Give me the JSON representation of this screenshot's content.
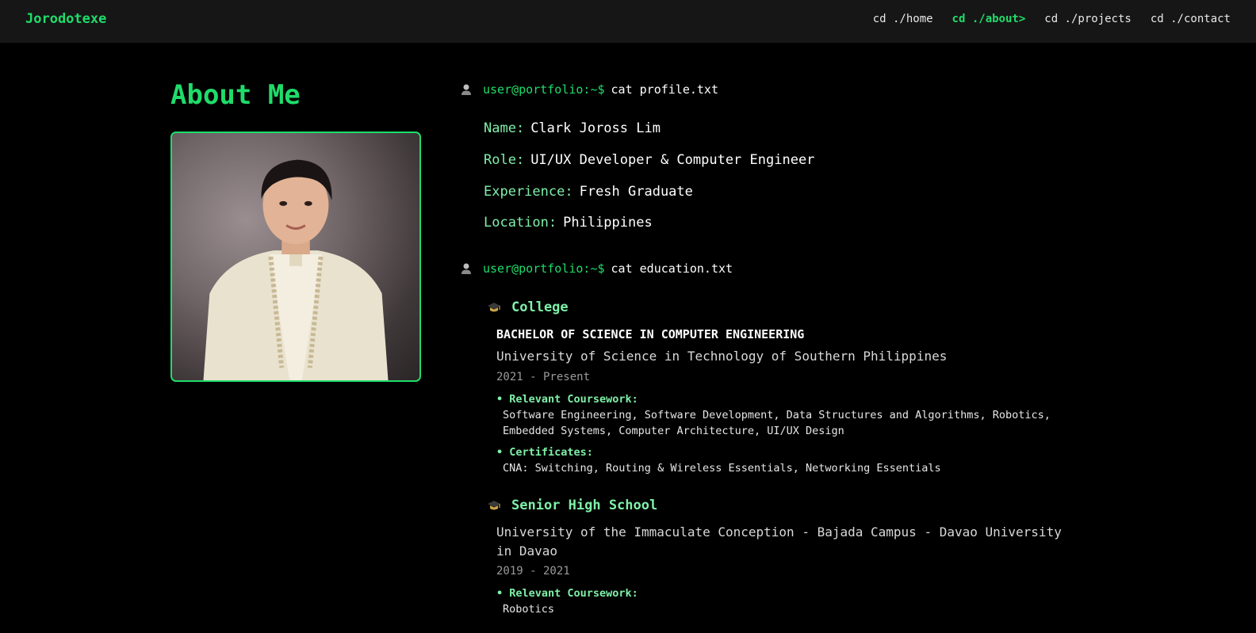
{
  "nav": {
    "brand": "Jorodotexe",
    "links": [
      "cd ./home",
      "cd ./about>",
      "cd ./projects",
      "cd ./contact"
    ]
  },
  "about": {
    "title": "About Me"
  },
  "terminal": {
    "prompt_user": "user@portfolio:~$",
    "cmd_profile": "cat profile.txt",
    "cmd_education": "cat education.txt"
  },
  "profile": {
    "name_key": "Name:",
    "name_val": "Clark Joross Lim",
    "role_key": "Role:",
    "role_val": "UI/UX Developer & Computer Engineer",
    "exp_key": "Experience:",
    "exp_val": "Fresh Graduate",
    "loc_key": "Location:",
    "loc_val": "Philippines"
  },
  "education": {
    "college": {
      "heading": "College",
      "degree": "BACHELOR OF SCIENCE IN COMPUTER ENGINEERING",
      "school": "University of Science in Technology of Southern Philippines",
      "years": "2021 - Present",
      "coursework_label": "• Relevant Coursework:",
      "coursework": "Software Engineering, Software Development, Data Structures and Algorithms, Robotics, Embedded Systems, Computer Architecture, UI/UX Design",
      "certs_label": "• Certificates:",
      "certs": "CNA: Switching, Routing & Wireless Essentials, Networking Essentials"
    },
    "shs": {
      "heading": "Senior High School",
      "school": "University of the Immaculate Conception - Bajada Campus - Davao University in Davao",
      "years": "2019 - 2021",
      "coursework_label": "• Relevant Coursework:",
      "coursework": "Robotics"
    }
  },
  "colors": {
    "accent": "#1fdc6a",
    "accent_light": "#7ff0a8",
    "bg": "#000000",
    "nav_bg": "#161616"
  },
  "icons": {
    "prompt": "user-icon",
    "education": "graduation-cap-icon"
  }
}
